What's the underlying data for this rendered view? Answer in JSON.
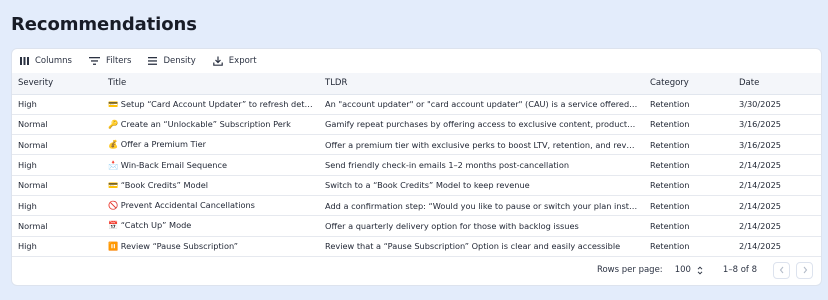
{
  "page": {
    "title": "Recommendations"
  },
  "toolbar": {
    "columns_label": "Columns",
    "filters_label": "Filters",
    "density_label": "Density",
    "export_label": "Export"
  },
  "table": {
    "headers": [
      "Severity",
      "Title",
      "TLDR",
      "Category",
      "Date"
    ],
    "rows": [
      [
        "High",
        "💳 Setup “Card Account Updater” to refresh details ...",
        "An \"account updater\" or \"card account updater\" (CAU) is a service offered by cr...",
        "Retention",
        "3/30/2025"
      ],
      [
        "Normal",
        "🔑 Create an “Unlockable” Subscription Perk",
        "Gamify repeat purchases by offering access to exclusive content, products, or di...",
        "Retention",
        "3/16/2025"
      ],
      [
        "Normal",
        "💰 Offer a Premium Tier",
        "Offer a premium tier with exclusive perks to boost LTV, retention, and revenue",
        "Retention",
        "3/16/2025"
      ],
      [
        "High",
        "📩 Win-Back Email Sequence",
        "Send friendly check-in emails 1–2 months post-cancellation",
        "Retention",
        "2/14/2025"
      ],
      [
        "Normal",
        "💳 “Book Credits” Model",
        "Switch to a “Book Credits” Model to keep revenue",
        "Retention",
        "2/14/2025"
      ],
      [
        "High",
        "🚫 Prevent Accidental Cancellations",
        "Add a confirmation step: “Would you like to pause or switch your plan instead?”",
        "Retention",
        "2/14/2025"
      ],
      [
        "Normal",
        "📅 “Catch Up” Mode",
        "Offer a quarterly delivery option for those with backlog issues",
        "Retention",
        "2/14/2025"
      ],
      [
        "High",
        "⏸️ Review “Pause Subscription”",
        "Review that a “Pause Subscription” Option is clear and easily accessible",
        "Retention",
        "2/14/2025"
      ]
    ]
  },
  "pagination": {
    "rows_per_page_label": "Rows per page:",
    "rows_per_page_value": "100",
    "range_text": "1–8 of 8"
  }
}
